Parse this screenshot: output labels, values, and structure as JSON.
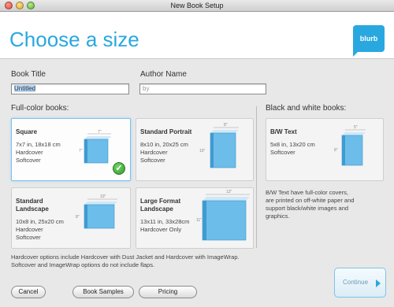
{
  "window": {
    "title": "New Book Setup"
  },
  "header": {
    "title": "Choose a size",
    "logo_text": "blurb"
  },
  "form": {
    "book_title_label": "Book Title",
    "book_title_value": "Untitled",
    "author_label": "Author Name",
    "author_placeholder": "by"
  },
  "sections": {
    "full_color": "Full-color books:",
    "bw": "Black and white books:"
  },
  "cards": [
    {
      "name": "Square",
      "lines": [
        "7x7 in, 18x18 cm",
        "Hardcover",
        "Softcover"
      ],
      "dim_top": "7\"",
      "dim_side": "7\"",
      "selected": true
    },
    {
      "name": "Standard Portrait",
      "lines": [
        "8x10 in, 20x25 cm",
        "Hardcover",
        "Softcover"
      ],
      "dim_top": "8\"",
      "dim_side": "10\"",
      "selected": false
    },
    {
      "name": "Standard Landscape",
      "name_lines": [
        "Standard",
        "Landscape"
      ],
      "lines": [
        "10x8 in, 25x20 cm",
        "Hardcover",
        "Softcover"
      ],
      "dim_top": "10\"",
      "dim_side": "8\"",
      "selected": false
    },
    {
      "name": "Large Format Landscape",
      "name_lines": [
        "Large Format",
        "Landscape"
      ],
      "lines": [
        "13x11 in, 33x28cm",
        "Hardcover Only"
      ],
      "dim_top": "13\"",
      "dim_side": "11\"",
      "selected": false
    },
    {
      "name": "B/W Text",
      "lines": [
        "5x8 in, 13x20 cm",
        "Softcover"
      ],
      "dim_top": "5\"",
      "dim_side": "8\"",
      "selected": false
    }
  ],
  "bw_note": [
    "B/W Text have full-color covers,",
    "are printed on off-white paper and",
    "support black/white images and",
    "graphics."
  ],
  "footer_note": [
    "Hardcover options include Hardcover with Dust Jacket and Hardcover with ImageWrap.",
    "Softcover and ImageWrap options do not include flaps."
  ],
  "buttons": {
    "cancel": "Cancel",
    "samples": "Book Samples",
    "pricing": "Pricing",
    "continue": "Continue"
  },
  "colors": {
    "accent": "#29a8e0",
    "check": "#2e9b2a"
  }
}
